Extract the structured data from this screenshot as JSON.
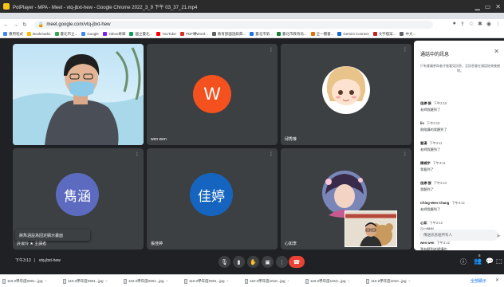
{
  "window": {
    "title": "PotPlayer - MPA - Meet - vtq-jbxt-hew - Google Chrome 2022_3_9 下午 03_37_21.mp4",
    "controls": [
      "▁",
      "▭",
      "✕"
    ]
  },
  "browser": {
    "url": "meet.google.com/vtq-jbxt-hew",
    "bookmarks": [
      {
        "label": "應用程式",
        "color": "#4285f4"
      },
      {
        "label": "Bookmarks",
        "color": "#fbbc04"
      },
      {
        "label": "臺北市立...",
        "color": "#34a853"
      },
      {
        "label": "Google",
        "color": "#4285f4"
      },
      {
        "label": "Yahoo奇摩",
        "color": "#7e1fff"
      },
      {
        "label": "國立臺北...",
        "color": "#0f9d58"
      },
      {
        "label": "YouTube",
        "color": "#ff0000"
      },
      {
        "label": "PDF轉Word...",
        "color": "#d93025"
      },
      {
        "label": "教育部國語辭典...",
        "color": "#5f6368"
      },
      {
        "label": "臺北市第...",
        "color": "#1a73e8"
      },
      {
        "label": "臺北市教育局...",
        "color": "#188038"
      },
      {
        "label": "全一體書...",
        "color": "#e37400"
      },
      {
        "label": "Gemini Connect",
        "color": "#1967d2"
      },
      {
        "label": "文字檔案...",
        "color": "#c5221f"
      },
      {
        "label": "中文...",
        "color": "#5f6368"
      }
    ]
  },
  "participants": [
    {
      "name": "",
      "kind": "video"
    },
    {
      "name": "wen wen",
      "kind": "letter",
      "letter": "W"
    },
    {
      "name": "邱秀琳",
      "kind": "avatar"
    },
    {
      "name": "許淑玲 ★ 主講者",
      "kind": "text",
      "label": "雋涵",
      "color": "#5c6bc0"
    },
    {
      "name": "張佳婷",
      "kind": "text",
      "label": "佳婷",
      "color": "#1565c0"
    },
    {
      "name": "心如李",
      "kind": "avatar"
    }
  ],
  "pin_popup": "將雋涵設為固定顯示畫面",
  "chat": {
    "title": "通話中的訊息",
    "notice": "只有會議參與者才能看見訊息，且訊息會在通話結束後刪除。",
    "messages": [
      {
        "sender": "佳婷 張",
        "time": "下午3:10",
        "text": "老師我聽到了"
      },
      {
        "sender": "lin",
        "time": "下午3:10",
        "text": "剛剛講的我聽到了"
      },
      {
        "sender": "慧滿",
        "time": "下午3:11",
        "text": "老師我聽到了"
      },
      {
        "sender": "陳威宇",
        "time": "下午3:11",
        "text": "我看到了"
      },
      {
        "sender": "佳婷 張",
        "time": "下午3:12",
        "text": "我聽到了"
      },
      {
        "sender": "Ching-Wen Chang",
        "time": "下午3:12",
        "text": "老師我聽到了"
      },
      {
        "sender": "心如",
        "time": "下午3:12",
        "text": "可以聽到"
      },
      {
        "sender": "wen wen",
        "time": "下午3:12",
        "text": "我有聽到老師講的"
      }
    ],
    "placeholder": "傳送訊息給所有人"
  },
  "meeting": {
    "time": "下午3:13",
    "code": "vtq-jbxt-hew",
    "participant_count": "8"
  },
  "downloads": {
    "files": [
      "110-2學年度0301...jpg",
      "110-2學年度0301...jpg",
      "110-2學年度0301...jpg",
      "110-2學年度0301...jpg",
      "110-2學年度1010...jpg",
      "110-2學年度1010...jpg",
      "110-2學年度1010...jpg"
    ],
    "show_all": "全部顯示"
  }
}
